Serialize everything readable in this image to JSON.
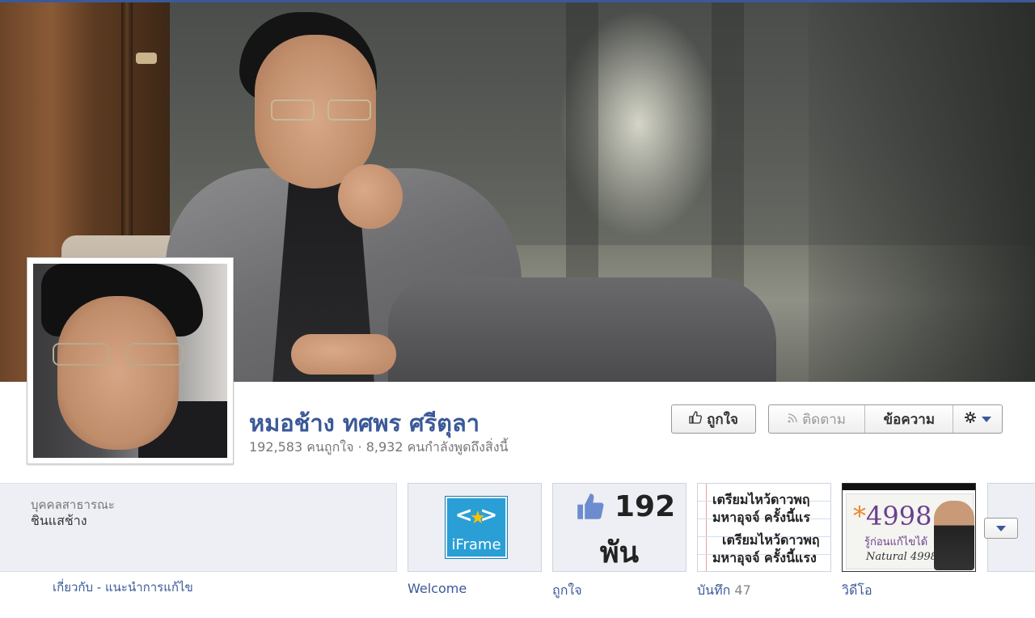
{
  "profile": {
    "name": "หมอช้าง ทศพร ศรีตุลา",
    "stats": "192,583 คนถูกใจ · 8,932 คนกำลังพูดถึงสิ่งนี้"
  },
  "actions": {
    "like": "ถูกใจ",
    "follow": "ติดตาม",
    "message": "ข้อความ"
  },
  "about": {
    "category": "บุคคลสาธารณะ",
    "description": "ชินแสช้าง",
    "link_about": "เกี่ยวกับ",
    "separator": " - ",
    "link_suggest": "แนะนำการแก้ไข"
  },
  "tiles": [
    {
      "label": "Welcome",
      "logo_brackets": "< >",
      "logo_text": "iFrame"
    },
    {
      "label": "ถูกใจ",
      "number": "192",
      "unit": "พัน"
    },
    {
      "label": "บันทึก",
      "count": "47",
      "lines": [
        "เตรียมไหว้ดาวพฤ",
        "มหาอุจจ์ ครั้งนี้แร",
        "เตรียมไหว้ดาวพฤ",
        "มหาอุจจ์ ครั้งนี้แรง"
      ]
    },
    {
      "label": "วิดีโอ",
      "promo_number": "4998",
      "promo_sub": "รู้ก่อนแก้ไขได้",
      "promo_sig": "Natural 4998"
    }
  ],
  "icons": {
    "like_button": "thumbs-up-icon",
    "follow_button": "rss-icon",
    "gear": "gear-icon",
    "dropdown": "chevron-down-icon"
  },
  "colors": {
    "brand": "#3b5998",
    "tile_bg": "#edeff4"
  }
}
